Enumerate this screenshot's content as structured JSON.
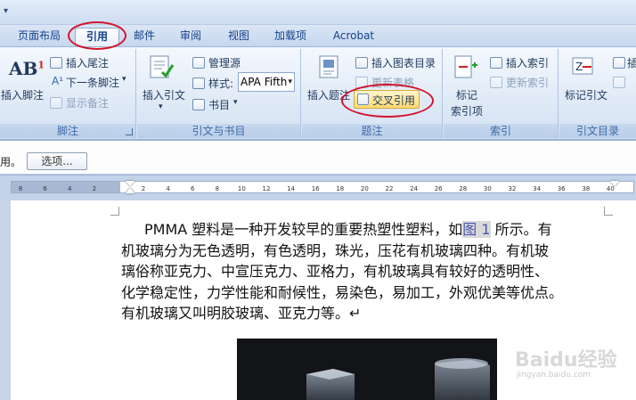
{
  "ribbon_tabs": [
    {
      "label": "页面布局"
    },
    {
      "label": "引用"
    },
    {
      "label": "邮件"
    },
    {
      "label": "审阅"
    },
    {
      "label": "视图"
    },
    {
      "label": "加载项"
    },
    {
      "label": "Acrobat"
    }
  ],
  "groups": {
    "footnotes": {
      "label": "脚注",
      "insert_footnote": "插入脚注",
      "insert_endnote": "插入尾注",
      "next_footnote": "下一条脚注",
      "show_notes": "显示备注"
    },
    "citations": {
      "label": "引文与书目",
      "insert_citation": "插入引文",
      "manage_sources": "管理源",
      "style_label": "样式:",
      "style_value": "APA Fifth",
      "bibliography": "书目"
    },
    "captions": {
      "label": "题注",
      "insert_caption": "插入题注",
      "insert_table_of_figures": "插入图表目录",
      "update_table": "更新表格",
      "cross_reference": "交叉引用"
    },
    "index": {
      "label": "索引",
      "mark_entry_line1": "标记",
      "mark_entry_line2": "索引项",
      "insert_index": "插入索引",
      "update_index": "更新索引"
    },
    "table_of_authorities": {
      "label": "引文目录",
      "mark_citation": "标记引文",
      "insert_glyph": "插"
    }
  },
  "message_bar": {
    "text": "用。",
    "options_button": "选项..."
  },
  "ruler_ticks": [
    "8",
    "6",
    "4",
    "2",
    "",
    "2",
    "4",
    "6",
    "8",
    "10",
    "12",
    "14",
    "16",
    "18",
    "20",
    "22",
    "24",
    "26",
    "28",
    "30",
    "32",
    "34",
    "36",
    "38",
    "40"
  ],
  "document": {
    "lines": [
      {
        "pre": "PMMA 塑料是一种开发较早的重要热塑性塑料，如",
        "ref": "图 1",
        "post": " 所示。有"
      },
      {
        "pre": "机玻璃分为无色透明，有色透明，珠光，压花有机玻璃四种。有机玻"
      },
      {
        "pre": "璃俗称亚克力、中宣压克力、亚格力，有机玻璃具有较好的透明性、"
      },
      {
        "pre": "化学稳定性，力学性能和耐候性，易染色，易加工，外观优美等优点。"
      },
      {
        "pre": "有机玻璃又叫明胶玻璃、亚克力等。↵"
      }
    ]
  },
  "watermark": {
    "brand": "Baidu经验",
    "sub": "jingyan.baidu.com"
  },
  "colors": {
    "ribbon_bg": "#dce8f6",
    "accent_blue": "#15428b",
    "highlight_gold": "#ffd971",
    "annotation_red": "#d3142b"
  },
  "icons": {
    "footnote": "ab1-footnote-icon",
    "citation": "insert-citation-icon",
    "caption": "insert-caption-icon",
    "index": "mark-entry-icon",
    "authorities": "mark-citation-icon"
  }
}
